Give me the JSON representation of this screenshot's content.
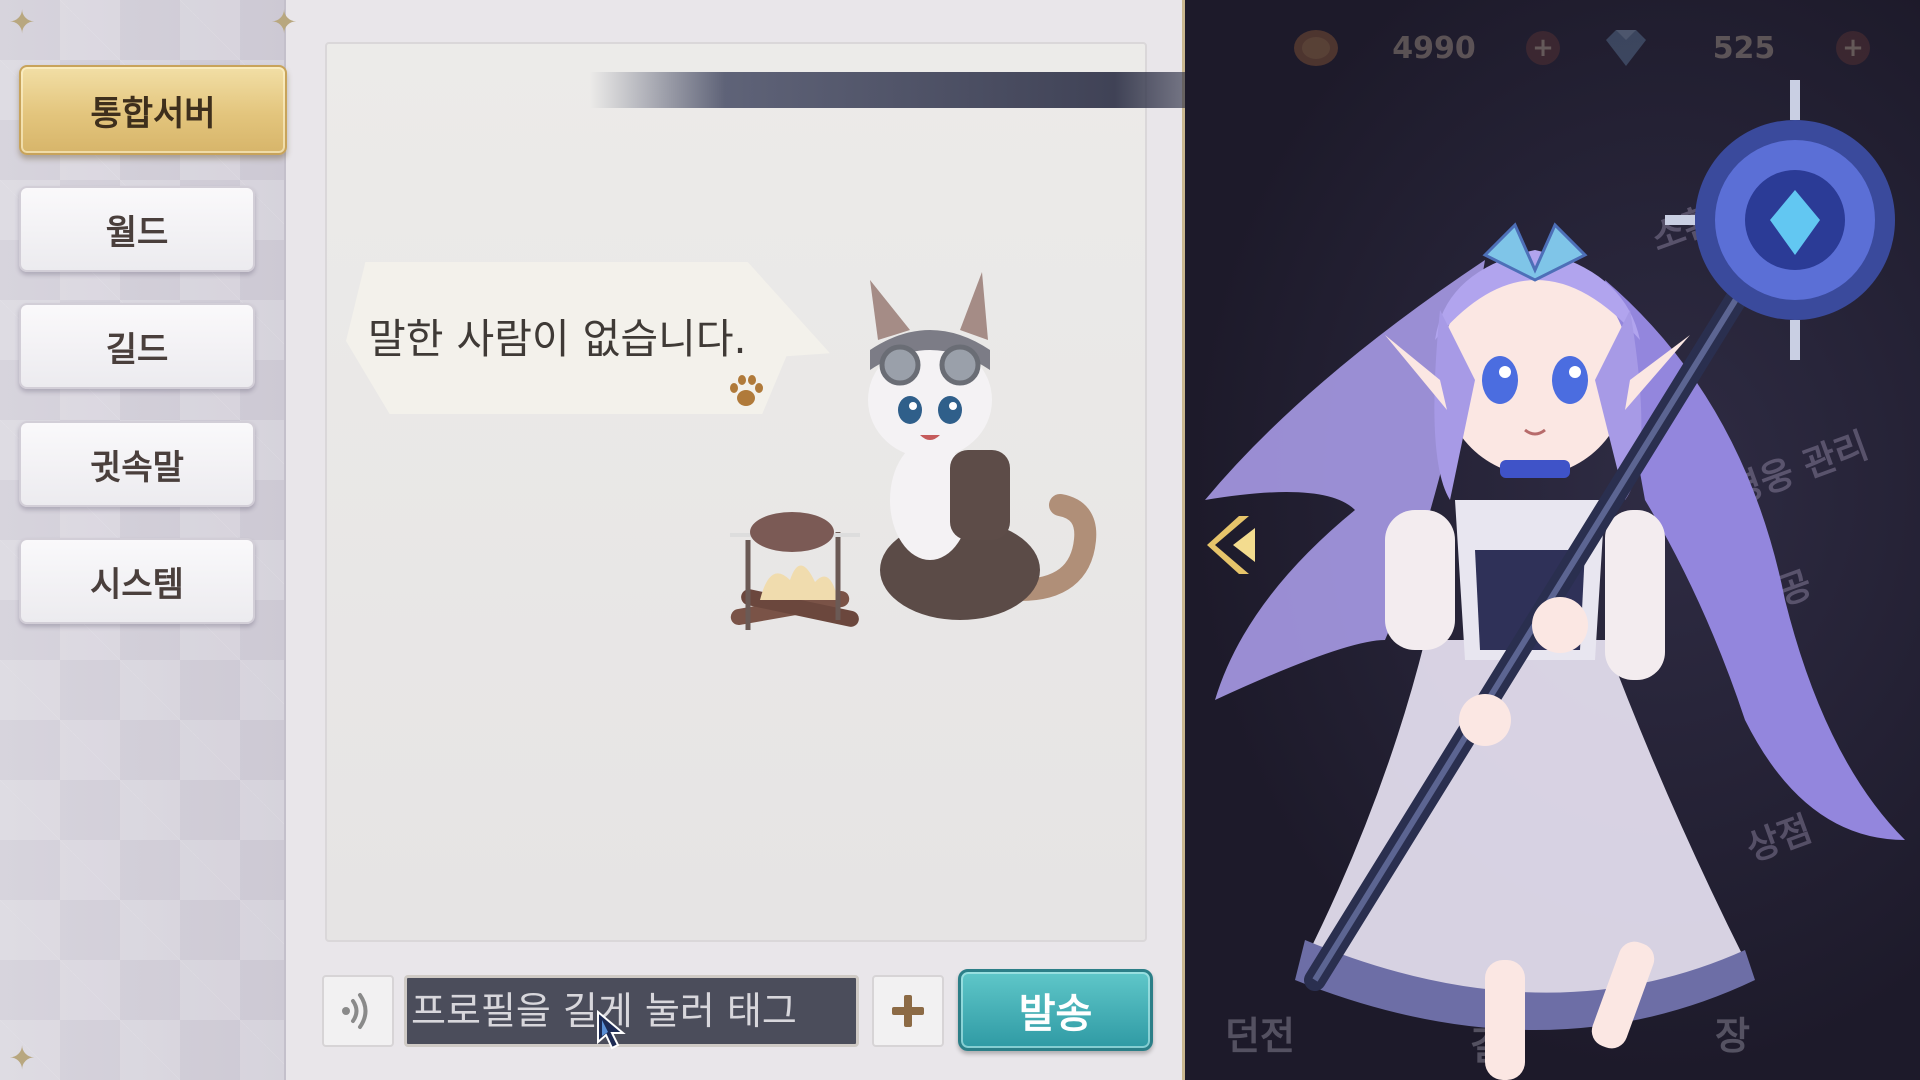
{
  "chat": {
    "tabs": [
      {
        "label": "통합서버",
        "active": true
      },
      {
        "label": "월드",
        "active": false
      },
      {
        "label": "길드",
        "active": false
      },
      {
        "label": "귓속말",
        "active": false
      },
      {
        "label": "시스템",
        "active": false
      }
    ],
    "empty_message": "말한 사람이 없습니다.",
    "input_placeholder": "프로필을 길게 눌러 태그",
    "send_label": "발송"
  },
  "currency": [
    {
      "icon": "coin-icon",
      "value": "4990"
    },
    {
      "icon": "diamond-icon",
      "value": "525"
    }
  ],
  "background_menu": {
    "side_labels": [
      "소환",
      "영웅 관리",
      "세공",
      "상점"
    ],
    "bottom_labels": [
      "던전",
      "길",
      "장"
    ]
  },
  "colors": {
    "active_tab": "#e3c57d",
    "send_button": "#2f9aa4",
    "input_bg": "#4b4d5b",
    "hero_hair": "#a79ae6",
    "hero_accent": "#3f53c8"
  }
}
